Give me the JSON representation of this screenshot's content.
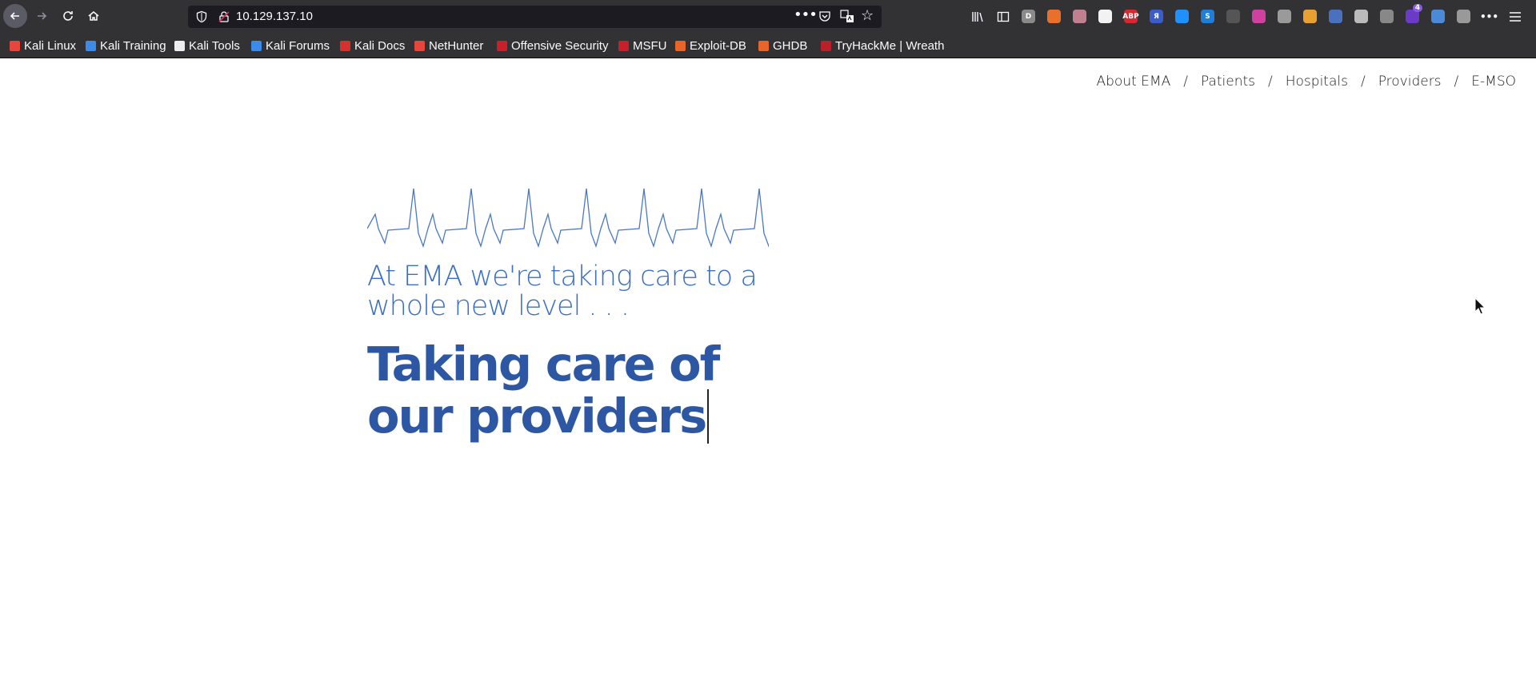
{
  "browser": {
    "url": "10.129.137.10",
    "bookmarks": [
      {
        "label": "Kali Linux",
        "icon": "kali-icon",
        "color": "#e8453c"
      },
      {
        "label": "Kali Training",
        "icon": "kali-training-icon",
        "color": "#3d8be8"
      },
      {
        "label": "Kali Tools",
        "icon": "kali-tools-icon",
        "color": "#eeeeee"
      },
      {
        "label": "Kali Forums",
        "icon": "kali-forums-icon",
        "color": "#3d8be8"
      },
      {
        "label": "Kali Docs",
        "icon": "kali-docs-icon",
        "color": "#d8302a"
      },
      {
        "label": "NetHunter",
        "icon": "nethunter-icon",
        "color": "#e8453c"
      },
      {
        "label": "Offensive Security",
        "icon": "offsec-icon",
        "color": "#c8202a"
      },
      {
        "label": "MSFU",
        "icon": "msfu-icon",
        "color": "#c8202a"
      },
      {
        "label": "Exploit-DB",
        "icon": "exploit-db-icon",
        "color": "#e8652a"
      },
      {
        "label": "GHDB",
        "icon": "ghdb-icon",
        "color": "#e8652a"
      },
      {
        "label": "TryHackMe | Wreath",
        "icon": "tryhackme-icon",
        "color": "#b8202a"
      }
    ],
    "extensions": [
      {
        "icon": "library-icon",
        "text": "",
        "color": "#323234"
      },
      {
        "icon": "sidebar-icon",
        "text": "",
        "color": "#323234"
      },
      {
        "icon": "d-extension-icon",
        "text": "D",
        "color": "#8a8a8a"
      },
      {
        "icon": "fox-extension-icon",
        "text": "",
        "color": "#e8702a"
      },
      {
        "icon": "paw-extension-icon",
        "text": "",
        "color": "#c08090"
      },
      {
        "icon": "location-extension-icon",
        "text": "",
        "color": "#f2f2f2"
      },
      {
        "icon": "adblock-icon",
        "text": "ABP",
        "color": "#d7282f"
      },
      {
        "icon": "yandex-icon",
        "text": "Я",
        "color": "#3a5ccc"
      },
      {
        "icon": "cube-extension-icon",
        "text": "",
        "color": "#1e90ff"
      },
      {
        "icon": "s-extension-icon",
        "text": "S",
        "color": "#1e7fd8"
      },
      {
        "icon": "tool-extension-icon",
        "text": "",
        "color": "#555555"
      },
      {
        "icon": "color-wheel-icon",
        "text": "",
        "color": "#d040a0"
      },
      {
        "icon": "gear-extension-icon",
        "text": "",
        "color": "#9a9a9a"
      },
      {
        "icon": "cat-extension-icon",
        "text": "",
        "color": "#e8a030"
      },
      {
        "icon": "globe-extension-icon",
        "text": "",
        "color": "#4a70c0"
      },
      {
        "icon": "check-extension-icon",
        "text": "",
        "color": "#bbbbbb"
      },
      {
        "icon": "cloud-extension-icon",
        "text": "",
        "color": "#888888"
      },
      {
        "icon": "badge-extension-icon",
        "text": "4",
        "color": "#6a3ac8"
      },
      {
        "icon": "translate-extension-icon",
        "text": "",
        "color": "#4a8ad8"
      },
      {
        "icon": "leaf-extension-icon",
        "text": "",
        "color": "#999999"
      },
      {
        "icon": "overflow-icon",
        "text": "",
        "color": "#323234"
      },
      {
        "icon": "hamburger-menu-icon",
        "text": "",
        "color": "#323234"
      }
    ]
  },
  "site": {
    "nav": [
      "About EMA",
      "Patients",
      "Hospitals",
      "Providers",
      "E-MSO"
    ],
    "nav_separator": "/",
    "tagline": "At EMA we're taking care to a whole new level . . .",
    "headline_line1": "Taking care of",
    "headline_line2": "our providers",
    "colors": {
      "tagline": "#3b6fc4",
      "headline": "#2e57a3",
      "ecg": "#4a78c4"
    }
  }
}
